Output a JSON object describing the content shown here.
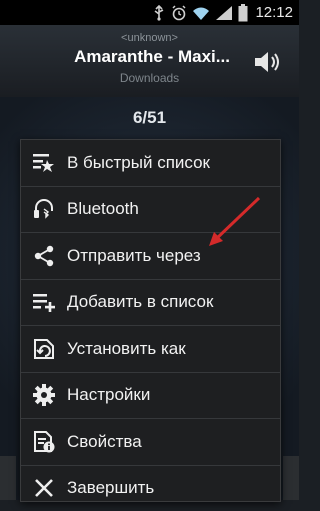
{
  "status_bar": {
    "time": "12:12",
    "icons": [
      "usb-icon",
      "alarm-icon",
      "wifi-icon",
      "signal-icon",
      "battery-icon"
    ]
  },
  "player": {
    "artist": "<unknown>",
    "title": "Amaranthe - Maxi...",
    "album": "Downloads",
    "track_counter": "6/51"
  },
  "menu": {
    "items": [
      {
        "label": "В быстрый список",
        "icon": "quick-list-icon"
      },
      {
        "label": "Bluetooth",
        "icon": "bluetooth-headset-icon"
      },
      {
        "label": "Отправить через",
        "icon": "share-icon"
      },
      {
        "label": "Добавить в список",
        "icon": "add-to-playlist-icon"
      },
      {
        "label": "Установить как",
        "icon": "set-as-icon"
      },
      {
        "label": "Настройки",
        "icon": "settings-gear-icon"
      },
      {
        "label": "Свойства",
        "icon": "properties-icon"
      },
      {
        "label": "Завершить",
        "icon": "close-x-icon"
      }
    ]
  },
  "annotation_color": "#d42a2a"
}
